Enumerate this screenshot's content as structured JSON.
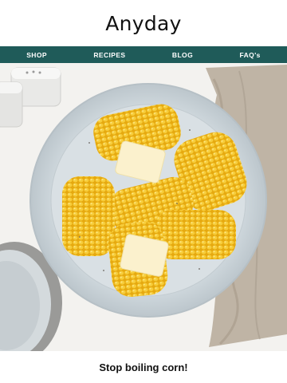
{
  "brand": {
    "logo_text": "Anyday"
  },
  "nav": {
    "items": [
      {
        "label": "SHOP"
      },
      {
        "label": "RECIPES"
      },
      {
        "label": "BLOG"
      },
      {
        "label": "FAQ's"
      }
    ],
    "background": "#1f5b59"
  },
  "hero": {
    "image_icon": "corn-on-the-cob-plate-photo"
  },
  "headline": {
    "text": "Stop boiling corn!"
  }
}
